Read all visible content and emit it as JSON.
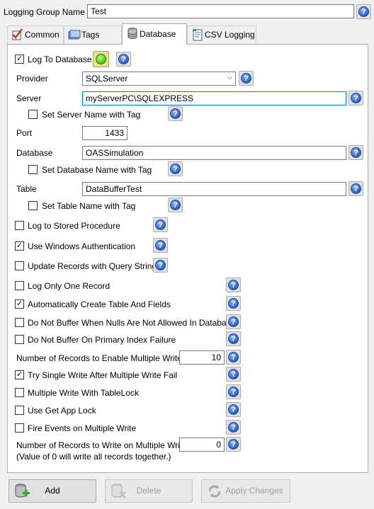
{
  "group_name": {
    "label": "Logging Group Name",
    "value": "Test"
  },
  "tabs": [
    {
      "label": "Common"
    },
    {
      "label": "Tags"
    },
    {
      "label": "Database"
    },
    {
      "label": "CSV Logging"
    }
  ],
  "log_to_db": {
    "label": "Log To Database",
    "checked": true
  },
  "provider": {
    "label": "Provider",
    "value": "SQLServer"
  },
  "server": {
    "label": "Server",
    "value": "myServerPC\\SQLEXPRESS",
    "tag_label": "Set Server Name with Tag"
  },
  "port": {
    "label": "Port",
    "value": "1433"
  },
  "database": {
    "label": "Database",
    "value": "OASSimulation",
    "tag_label": "Set Database Name with Tag"
  },
  "table": {
    "label": "Table",
    "value": "DataBufferTest",
    "tag_label": "Set Table Name with Tag"
  },
  "options": {
    "stored_proc": {
      "label": "Log to Stored Procedure",
      "checked": false
    },
    "win_auth": {
      "label": "Use Windows Authentication",
      "checked": true
    },
    "update_query": {
      "label": "Update Records with Query String",
      "checked": false
    },
    "only_one": {
      "label": "Log Only One Record",
      "checked": false
    },
    "auto_create": {
      "label": "Automatically Create Table And Fields",
      "checked": true
    },
    "no_buffer_nulls": {
      "label": "Do Not Buffer When Nulls Are Not Allowed In Database",
      "checked": false
    },
    "no_buffer_pk": {
      "label": "Do Not Buffer On Primary Index Failure",
      "checked": false
    },
    "multi_write_count": {
      "label": "Number of Records to Enable Multiple Write",
      "value": "10"
    },
    "try_single": {
      "label": "Try Single Write After Multiple Write Fail",
      "checked": true
    },
    "tablelock": {
      "label": "Multiple Write With TableLock",
      "checked": false
    },
    "app_lock": {
      "label": "Use Get App Lock",
      "checked": false
    },
    "fire_events": {
      "label": "Fire Events on Multiple Write",
      "checked": false
    },
    "write_count": {
      "label": "Number of Records to Write on Multiple Write",
      "note": "(Value of 0 will write all records together.)",
      "value": "0"
    }
  },
  "buttons": {
    "add": "Add",
    "delete": "Delete",
    "apply": "Apply Changes"
  },
  "icons": {
    "help": "help-icon",
    "status": "status-led-icon"
  },
  "colors": {
    "help_blue": "#1f57c2",
    "focus_border": "#0078d7",
    "led_green": "#5dd21b"
  }
}
